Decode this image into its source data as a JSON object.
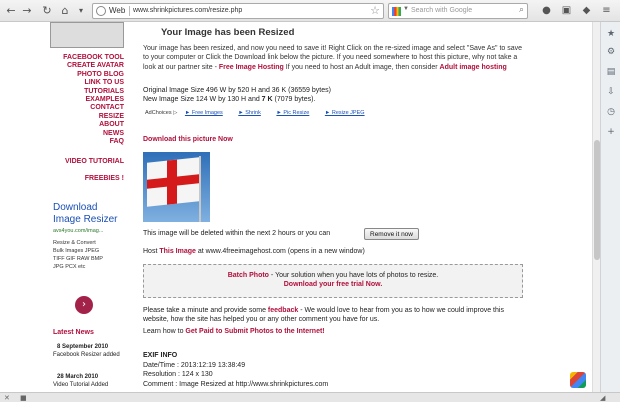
{
  "browser": {
    "url_label": "Web",
    "url": "www.shrinkpictures.com/resize.php",
    "search_placeholder": "Search with Google",
    "icons": {
      "back": "←",
      "forward": "→",
      "reload": "↻",
      "home": "⌂",
      "star": "☆",
      "search": "⌕"
    }
  },
  "nav": {
    "items": [
      "FACEBOOK TOOL",
      "CREATE AVATAR",
      "PHOTO BLOG",
      "LINK TO US",
      "TUTORIALS",
      "EXAMPLES",
      "CONTACT",
      "RESIZE",
      "ABOUT",
      "NEWS",
      "FAQ"
    ],
    "video_tutorial": "VIDEO TUTORIAL",
    "freebies": "FREEBIES !"
  },
  "ad": {
    "title": "Download Image Resizer",
    "url": "avs4you.com/imag...",
    "lines": [
      "Resize & Convert",
      "Bulk Images JPEG",
      "TIFF GIF RAW BMP",
      "JPG PCX etc"
    ],
    "arrow": "›"
  },
  "news": {
    "heading": "Latest News",
    "items": [
      {
        "date": "8 September 2010",
        "text": "Facebook Resizer added"
      },
      {
        "date": "28 March 2010",
        "text": "Video Tutorial Added"
      }
    ]
  },
  "main": {
    "title": "Your Image has been Resized",
    "para_1": "Your image has been resized, and now you need to save it!  Right Click on the re-sized image and select \"Save As\" to save to your computer or Click the Download link below the picture.  If you need somewhere to host this picture, why not take a look at our partner site - ",
    "para_link_1": "Free Image Hosting",
    "para_2": " If you need to host an Adult image, then consider ",
    "para_link_2": "Adult image hosting",
    "original_size": "Original Image Size 496 W by 520 H and 36 K (36559 bytes)",
    "new_size_prefix": "New Image Size 124 W by 130 H and ",
    "new_size_bold": "7 K",
    "new_size_suffix": " (7079 bytes).",
    "adchoices": "AdChoices",
    "ad_links": [
      "► Free Images",
      "► Shrink",
      "► Pic Resize",
      "► Resize JPEG"
    ],
    "download_link": "Download this picture Now",
    "delete_text": "This image will be deleted within the next 2 hours or you can",
    "remove_button": "Remove it now",
    "host_prefix": "Host ",
    "host_bold": "This Image",
    "host_suffix": " at www.4freeimagehost.com (opens in a new window)",
    "batch_bold": "Batch Photo",
    "batch_text": " - Your solution when you have lots of photos to resize.",
    "batch_trial": "Download your free trial Now.",
    "feedback_1": "Please take a minute and provide some ",
    "feedback_bold": "feedback",
    "feedback_2": " - We would love to hear from you as to how we could improve this website, how the site has helped you or any other comment you have for us.",
    "learn_prefix": "Learn how to ",
    "learn_bold": "Get Paid to Submit Photos to the Internet!",
    "exif_heading": "EXIF INFO",
    "exif_lines": [
      "Date/Time : 2013:12:19 13:38:49",
      "Resolution : 124 x 130",
      "Comment : Image Resized at http://www.shrinkpictures.com"
    ]
  },
  "colors": {
    "link_red": "#b0103c",
    "ad_blue": "#1a4fb5"
  }
}
